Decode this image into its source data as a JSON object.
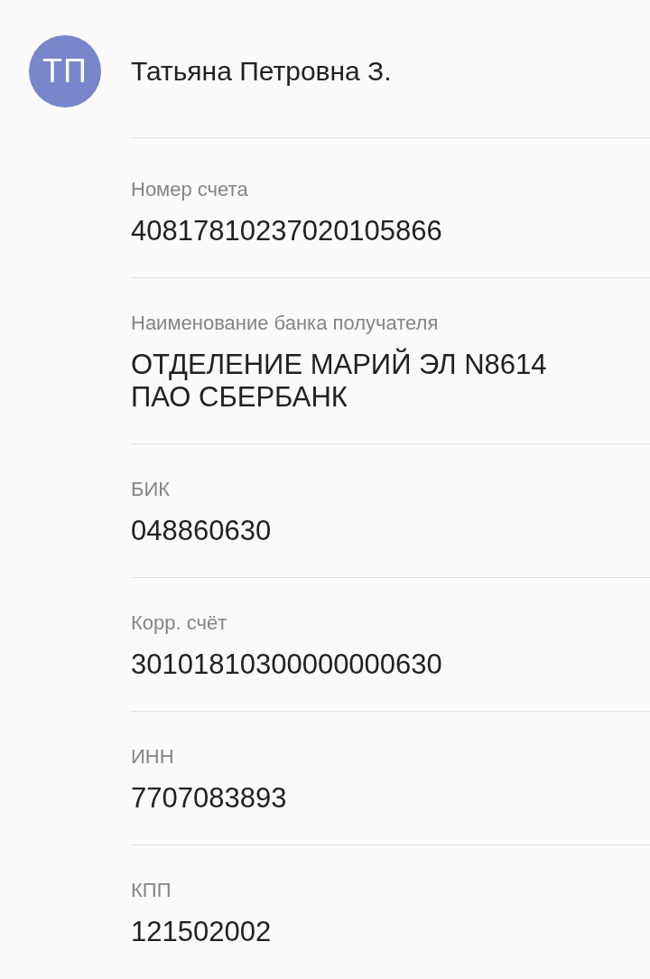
{
  "contact": {
    "initials": "ТП",
    "name": "Татьяна Петровна З."
  },
  "fields": [
    {
      "label": "Номер счета",
      "value": "40817810237020105866"
    },
    {
      "label": "Наименование банка получателя",
      "value": "ОТДЕЛЕНИЕ МАРИЙ ЭЛ N8614\nПАО СБЕРБАНК"
    },
    {
      "label": "БИК",
      "value": "048860630"
    },
    {
      "label": "Корр. счёт",
      "value": "30101810300000000630"
    },
    {
      "label": "ИНН",
      "value": "7707083893"
    },
    {
      "label": "КПП",
      "value": "121502002"
    }
  ]
}
